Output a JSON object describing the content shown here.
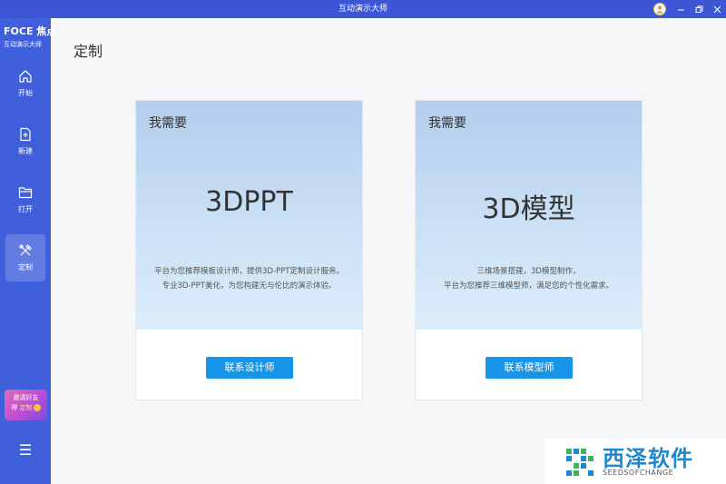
{
  "window": {
    "title": "互动演示大师"
  },
  "logo": {
    "brand": "FOCE 焦点",
    "subtitle": "互动演示大师"
  },
  "sidebar": {
    "items": [
      {
        "label": "开始",
        "icon": "home-icon",
        "active": false
      },
      {
        "label": "新建",
        "icon": "new-file-icon",
        "active": false
      },
      {
        "label": "打开",
        "icon": "folder-icon",
        "active": false
      },
      {
        "label": "定制",
        "icon": "tools-icon",
        "active": true
      }
    ],
    "invite": {
      "line1": "邀请好友",
      "line2_prefix": "得",
      "line2_highlight": "定制"
    }
  },
  "page": {
    "title": "定制"
  },
  "cards": [
    {
      "heading": "我需要",
      "title": "3DPPT",
      "desc_line1": "平台为您推荐模板设计师，提供3D-PPT定制设计服务。",
      "desc_line2": "专业3D-PPT美化，为您构建无与伦比的演示体验。",
      "button": "联系设计师"
    },
    {
      "heading": "我需要",
      "title": "3D模型",
      "desc_line1": "三维场景搭建，3D模型制作，",
      "desc_line2": "平台为您推荐三维模型师，满足您的个性化需求。",
      "button": "联系模型师"
    }
  ],
  "watermark": {
    "text": "西泽软件",
    "subtext": "SEEDSOFCHANGE"
  },
  "colors": {
    "sidebar": "#4060db",
    "titlebar": "#3d56d6",
    "button": "#1695e8"
  }
}
